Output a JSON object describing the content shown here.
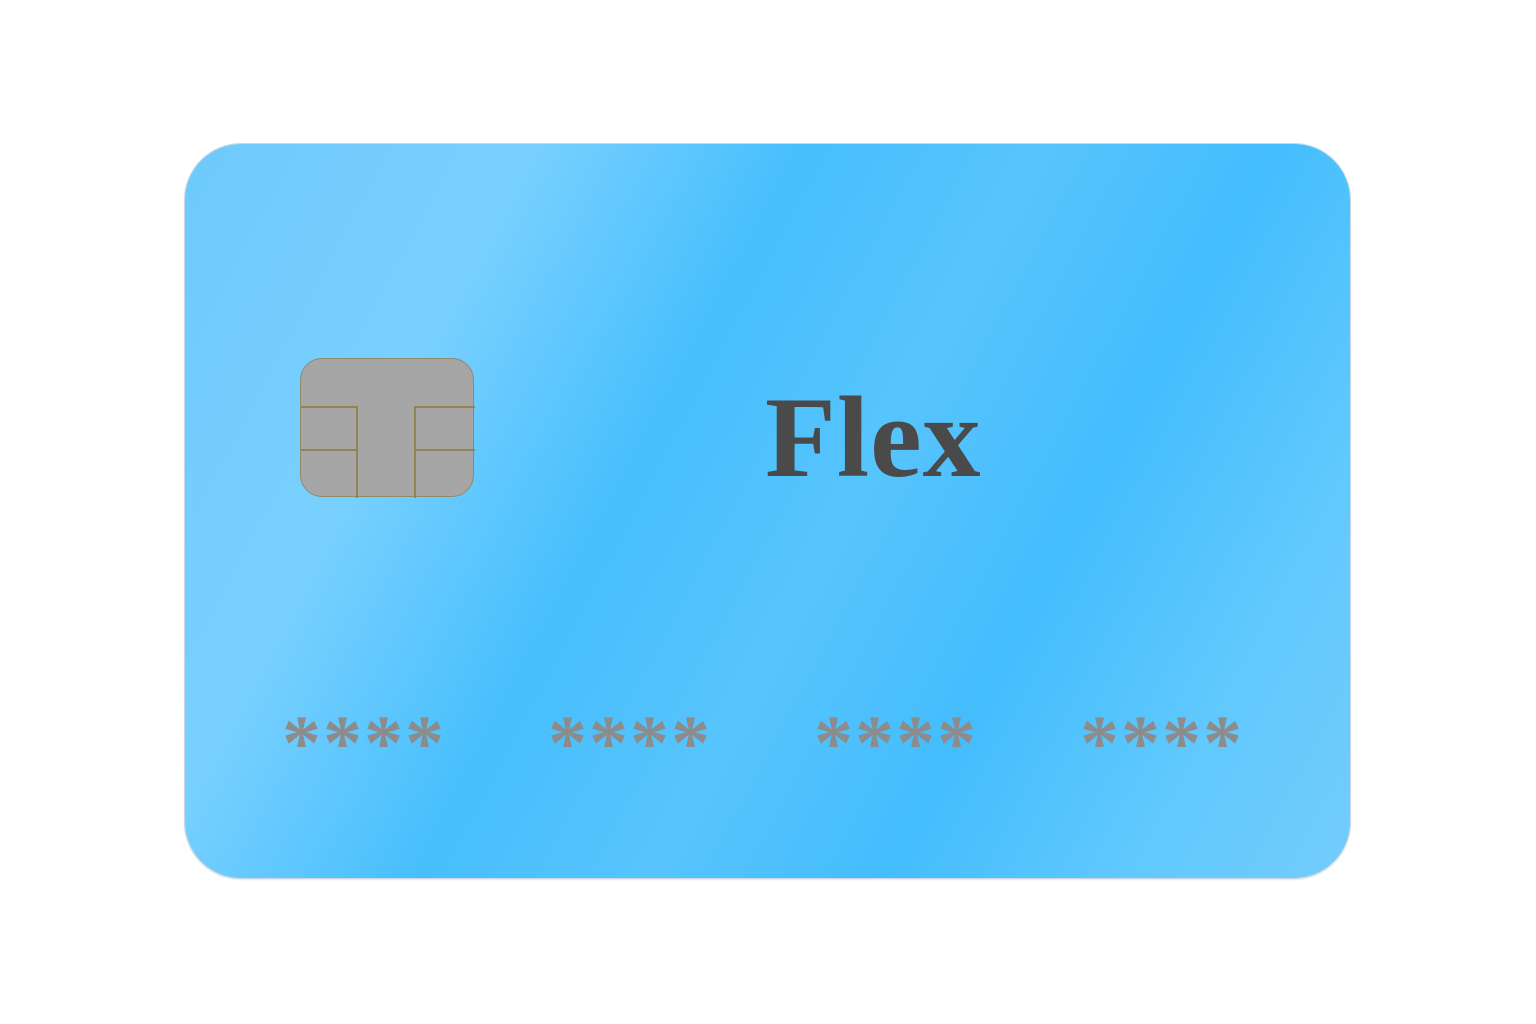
{
  "card": {
    "brand": "Flex",
    "number_groups": [
      "****",
      "****",
      "****",
      "****"
    ],
    "colors": {
      "card_base": "#52c3fd",
      "brand_text": "#4a4a4a",
      "number_text": "#8c8c8c",
      "chip": "#a6a6a6",
      "chip_lines": "#8a7a3a"
    },
    "icons": [
      "chip-icon"
    ]
  }
}
